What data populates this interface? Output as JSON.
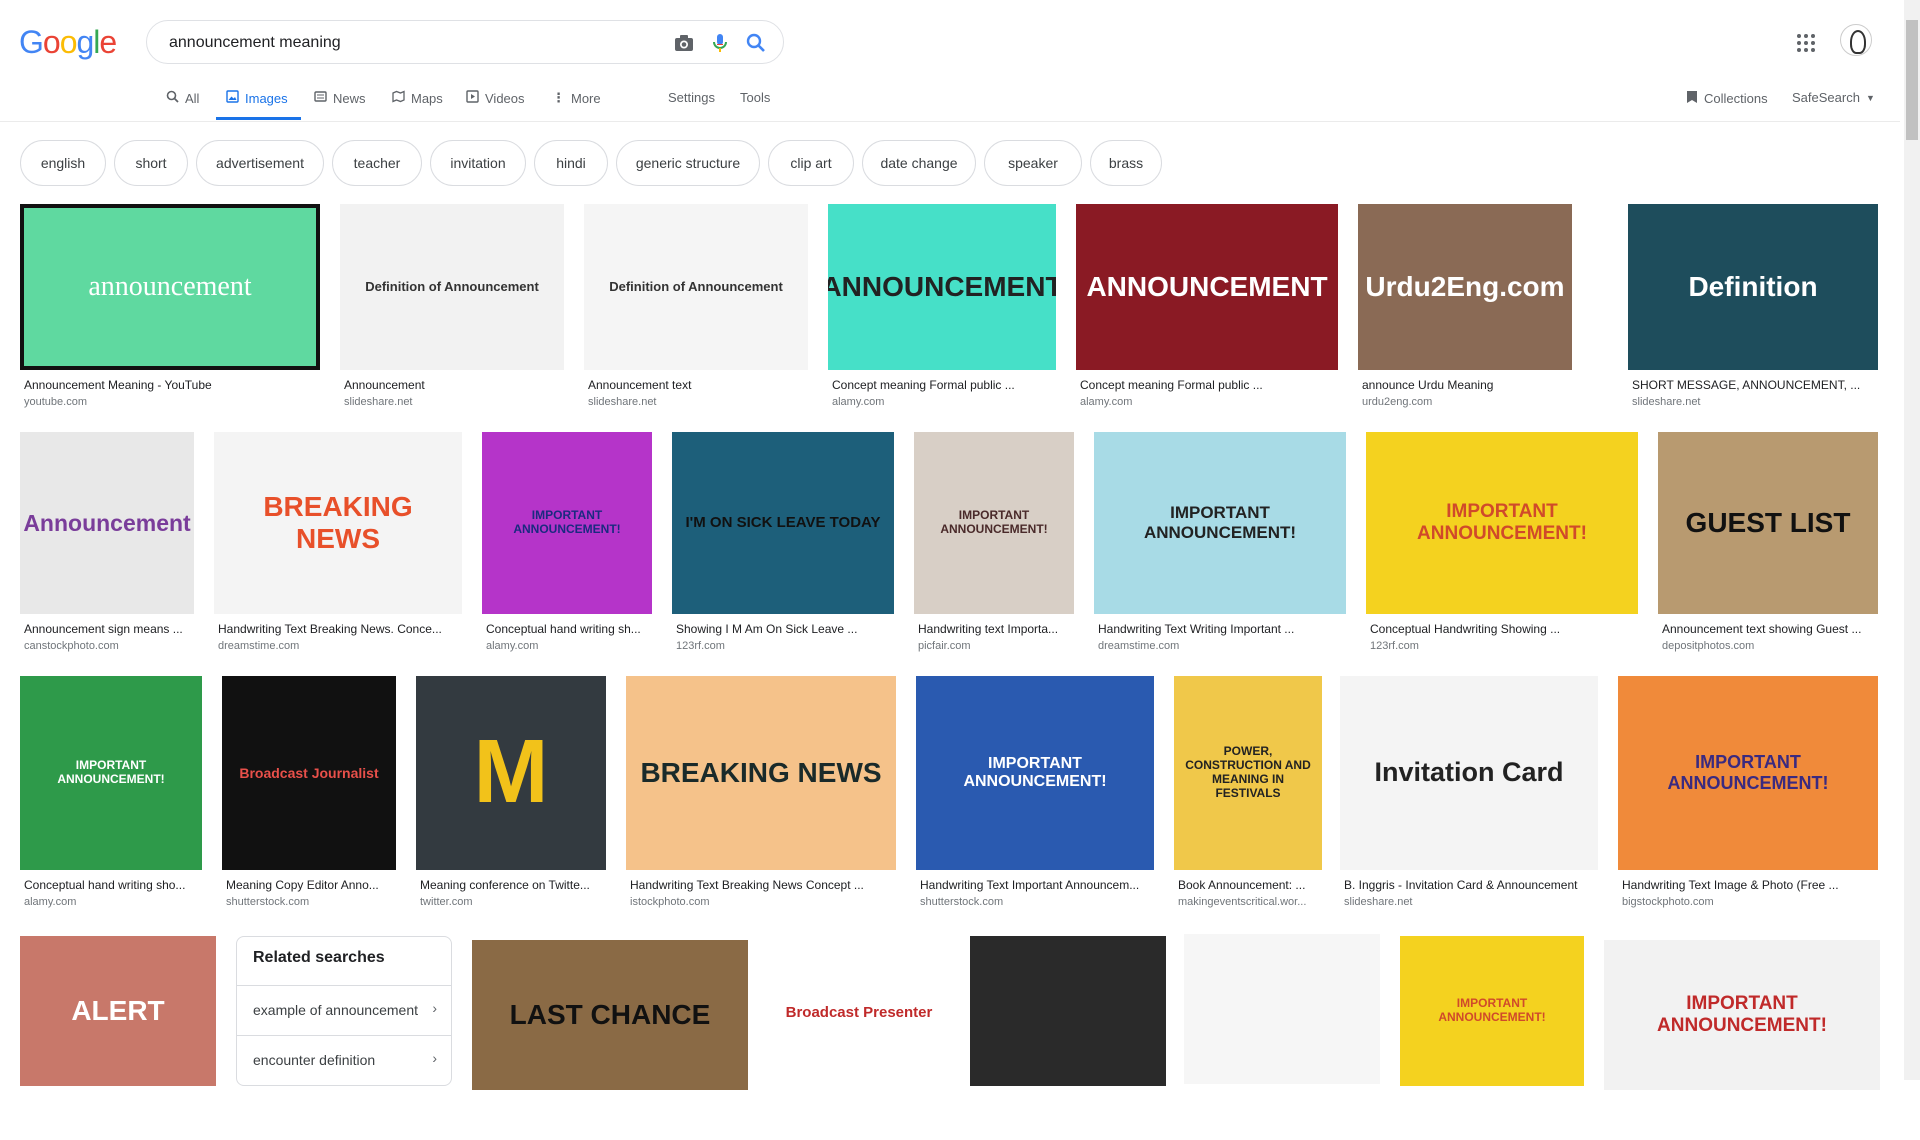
{
  "logo": [
    "G",
    "o",
    "o",
    "g",
    "l",
    "e"
  ],
  "search": {
    "value": "announcement meaning"
  },
  "tabs": [
    {
      "label": "All",
      "icon": "search-icon"
    },
    {
      "label": "Images",
      "icon": "image-icon"
    },
    {
      "label": "News",
      "icon": "news-icon"
    },
    {
      "label": "Maps",
      "icon": "map-icon"
    },
    {
      "label": "Videos",
      "icon": "video-icon"
    },
    {
      "label": "More",
      "icon": "more-vert-icon"
    },
    {
      "label": "Settings"
    },
    {
      "label": "Tools"
    }
  ],
  "right_tools": {
    "collections": "Collections",
    "safesearch": "SafeSearch"
  },
  "chips": [
    "english",
    "short",
    "advertisement",
    "teacher",
    "invitation",
    "hindi",
    "generic structure",
    "clip art",
    "date change",
    "speaker",
    "brass"
  ],
  "results": [
    {
      "title": "Announcement Meaning - YouTube",
      "source": "youtube.com",
      "thumb_text": "announcement",
      "bg": "#5fd9a0",
      "fg": "#ffffff"
    },
    {
      "title": "Announcement",
      "source": "slideshare.net",
      "thumb_text": "Definition of Announcement",
      "bg": "#f2f2f2",
      "fg": "#333333"
    },
    {
      "title": "Announcement text",
      "source": "slideshare.net",
      "thumb_text": "Definition of Announcement",
      "bg": "#f5f5f5",
      "fg": "#333333"
    },
    {
      "title": "Concept meaning Formal public ...",
      "source": "alamy.com",
      "thumb_text": "ANNOUNCEMENT",
      "bg": "#46e0c8",
      "fg": "#222222"
    },
    {
      "title": "Concept meaning Formal public ...",
      "source": "alamy.com",
      "thumb_text": "ANNOUNCEMENT",
      "bg": "#8a1a24",
      "fg": "#ffffff"
    },
    {
      "title": "announce Urdu Meaning",
      "source": "urdu2eng.com",
      "thumb_text": "Urdu2Eng.com",
      "bg": "#8a6a55",
      "fg": "#ffffff"
    },
    {
      "title": "SHORT MESSAGE, ANNOUNCEMENT, ...",
      "source": "slideshare.net",
      "thumb_text": "Definition",
      "bg": "#1e4d5c",
      "fg": "#ffffff"
    },
    {
      "title": "Announcement sign means ...",
      "source": "canstockphoto.com",
      "thumb_text": "Announcement",
      "bg": "#e8e8e8",
      "fg": "#7a3d9a"
    },
    {
      "title": "Handwriting Text Breaking News. Conce...",
      "source": "dreamstime.com",
      "thumb_text": "BREAKING NEWS",
      "bg": "#f4f4f4",
      "fg": "#e8502a"
    },
    {
      "title": "Conceptual hand writing sh...",
      "source": "alamy.com",
      "thumb_text": "IMPORTANT ANNOUNCEMENT!",
      "bg": "#b534c9",
      "fg": "#1a2a80"
    },
    {
      "title": "Showing I M Am On Sick Leave ...",
      "source": "123rf.com",
      "thumb_text": "I'M ON SICK LEAVE TODAY",
      "bg": "#1d5f7a",
      "fg": "#111111"
    },
    {
      "title": "Handwriting text Importa...",
      "source": "picfair.com",
      "thumb_text": "IMPORTANT ANNOUNCEMENT!",
      "bg": "#d8cfc6",
      "fg": "#4a2a2a"
    },
    {
      "title": "Handwriting Text Writing Important ...",
      "source": "dreamstime.com",
      "thumb_text": "IMPORTANT ANNOUNCEMENT!",
      "bg": "#a8dbe6",
      "fg": "#222222"
    },
    {
      "title": "Conceptual Handwriting Showing ...",
      "source": "123rf.com",
      "thumb_text": "IMPORTANT ANNOUNCEMENT!",
      "bg": "#f4d21f",
      "fg": "#d04a2a"
    },
    {
      "title": "Announcement text showing Guest ...",
      "source": "depositphotos.com",
      "thumb_text": "GUEST LIST",
      "bg": "#b89a70",
      "fg": "#111111"
    },
    {
      "title": "Conceptual hand writing sho...",
      "source": "alamy.com",
      "thumb_text": "IMPORTANT ANNOUNCEMENT!",
      "bg": "#2e9a4a",
      "fg": "#ffffff"
    },
    {
      "title": "Meaning Copy Editor Anno...",
      "source": "shutterstock.com",
      "thumb_text": "Broadcast Journalist",
      "bg": "#111111",
      "fg": "#e8504a"
    },
    {
      "title": "Meaning conference on Twitte...",
      "source": "twitter.com",
      "thumb_text": "M",
      "bg": "#333a40",
      "fg": "#f2c21a"
    },
    {
      "title": "Handwriting Text Breaking News Concept ...",
      "source": "istockphoto.com",
      "thumb_text": "BREAKING NEWS",
      "bg": "#f5c28a",
      "fg": "#1a2a2a"
    },
    {
      "title": "Handwriting Text Important Announcem...",
      "source": "shutterstock.com",
      "thumb_text": "IMPORTANT ANNOUNCEMENT!",
      "bg": "#2a5ab0",
      "fg": "#ffffff"
    },
    {
      "title": "Book Announcement: ...",
      "source": "makingeventscritical.wor...",
      "thumb_text": "POWER, CONSTRUCTION AND MEANING IN FESTIVALS",
      "bg": "#f0c84a",
      "fg": "#222222"
    },
    {
      "title": "B. Inggris - Invitation Card & Announcement",
      "source": "slideshare.net",
      "thumb_text": "Invitation Card",
      "bg": "#f4f4f4",
      "fg": "#222222"
    },
    {
      "title": "Handwriting Text Image & Photo (Free ...",
      "source": "bigstockphoto.com",
      "thumb_text": "IMPORTANT ANNOUNCEMENT!",
      "bg": "#f08a3a",
      "fg": "#3a2a80"
    },
    {
      "title": "",
      "source": "",
      "thumb_text": "ALERT",
      "bg": "#c8786a",
      "fg": "#ffffff"
    },
    {
      "title": "",
      "source": "",
      "thumb_text": "LAST CHANCE",
      "bg": "#8a6a45",
      "fg": "#111111"
    },
    {
      "title": "",
      "source": "",
      "thumb_text": "Broadcast Presenter",
      "bg": "#ffffff",
      "fg": "#c02a2a"
    },
    {
      "title": "",
      "source": "",
      "thumb_text": "",
      "bg": "#2a2a2a",
      "fg": "#ffffff"
    },
    {
      "title": "",
      "source": "",
      "thumb_text": "",
      "bg": "#f6f6f6",
      "fg": "#333333"
    },
    {
      "title": "",
      "source": "",
      "thumb_text": "IMPORTANT ANNOUNCEMENT!",
      "bg": "#f4d21f",
      "fg": "#d04a2a"
    },
    {
      "title": "",
      "source": "",
      "thumb_text": "IMPORTANT ANNOUNCEMENT!",
      "bg": "#f2f2f2",
      "fg": "#c02a2a"
    }
  ],
  "related": {
    "heading": "Related searches",
    "items": [
      "example of announcement",
      "encounter definition"
    ]
  }
}
